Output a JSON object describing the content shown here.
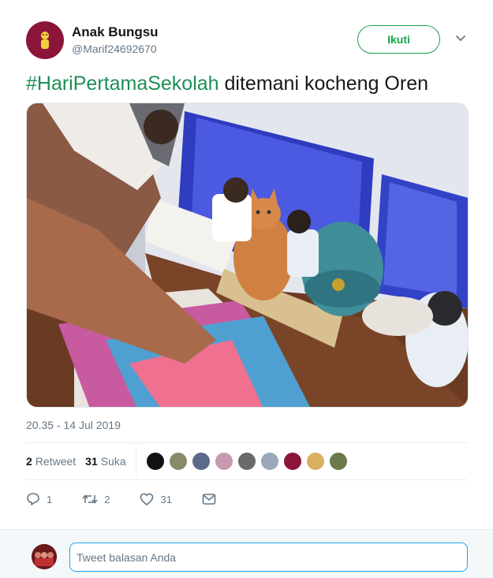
{
  "user": {
    "name": "Anak Bungsu",
    "handle": "@Marif24692670",
    "avatar_color": "#8b1538"
  },
  "follow_button": {
    "label": "Ikuti",
    "color": "#17a34a"
  },
  "tweet": {
    "hashtag": "#HariPertamaSekolah",
    "text": " ditemani kocheng Oren",
    "hashtag_color": "#1e8e56"
  },
  "timestamp": "20.35 - 14 Jul 2019",
  "stats": {
    "retweet_count": "2",
    "retweet_label": "Retweet",
    "like_count": "31",
    "like_label": "Suka",
    "liker_avatar_colors": [
      "#111111",
      "#8a8a6a",
      "#5a6a8a",
      "#c89ab0",
      "#6a6a6a",
      "#9aa8b8",
      "#8b1538",
      "#d8b060",
      "#6a7a4a"
    ]
  },
  "actions": {
    "reply_count": "1",
    "retweet_count": "2",
    "like_count": "31"
  },
  "reply": {
    "placeholder": "Tweet balasan Anda"
  },
  "icons": [
    "chevron-down-icon",
    "reply-icon",
    "retweet-icon",
    "heart-icon",
    "message-icon"
  ]
}
